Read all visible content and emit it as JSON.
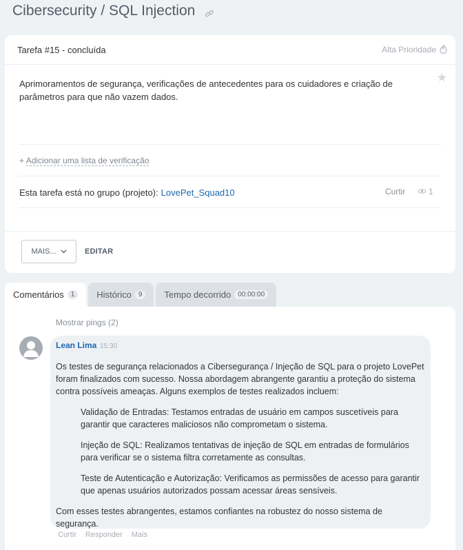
{
  "page": {
    "title": "Cibersecurity / SQL Injection"
  },
  "task": {
    "number_status": "Tarefa #15 - concluída",
    "priority": "Alta Prioridade",
    "description": "Aprimoramentos de segurança, verificações de antecedentes para os cuidadores e criação de parâmetros para que não vazem dados.",
    "add_checklist_prefix": "+ ",
    "add_checklist": "Adicionar uma lista de verificação",
    "group_label": "Esta tarefa está no grupo (projeto):",
    "group_name": "LovePet_Squad10",
    "like_label": "Curtir",
    "views_count": "1"
  },
  "actions": {
    "more_label": "MAIS...",
    "edit_label": "EDITAR"
  },
  "tabs": [
    {
      "label": "Comentários",
      "count": "1"
    },
    {
      "label": "Histórico",
      "count": "9"
    },
    {
      "label": "Tempo decorrido",
      "count": "00:00:00"
    }
  ],
  "comments": {
    "show_pings": "Mostrar pings (2)",
    "items": [
      {
        "author": "Lean Lima",
        "time": "15:30",
        "intro": "Os testes de segurança relacionados a Cibersegurança / Injeção de SQL para o projeto LovePet foram finalizados com sucesso. Nossa abordagem abrangente garantiu a proteção do sistema contra possíveis ameaças. Alguns exemplos de testes realizados incluem:",
        "points": [
          "Validação de Entradas: Testamos entradas de usuário em campos suscetíveis para garantir que caracteres maliciosos não comprometam o sistema.",
          "Injeção de SQL: Realizamos tentativas de injeção de SQL em entradas de formulários para verificar se o sistema filtra corretamente as consultas.",
          "Teste de Autenticação e Autorização: Verificamos as permissões de acesso para garantir que apenas usuários autorizados possam acessar áreas sensíveis."
        ],
        "outro": "Com esses testes abrangentes, estamos confiantes na robustez do nosso sistema de segurança.",
        "actions": [
          "Curtir",
          "Responder",
          "Mais"
        ]
      }
    ]
  },
  "colors": {
    "background": "#eef2f4",
    "link": "#2067b0",
    "bubble": "#eef1f4"
  },
  "icons": [
    "link-icon",
    "flame-icon",
    "star-icon",
    "eye-icon",
    "chevron-down-icon",
    "user-avatar-icon"
  ]
}
